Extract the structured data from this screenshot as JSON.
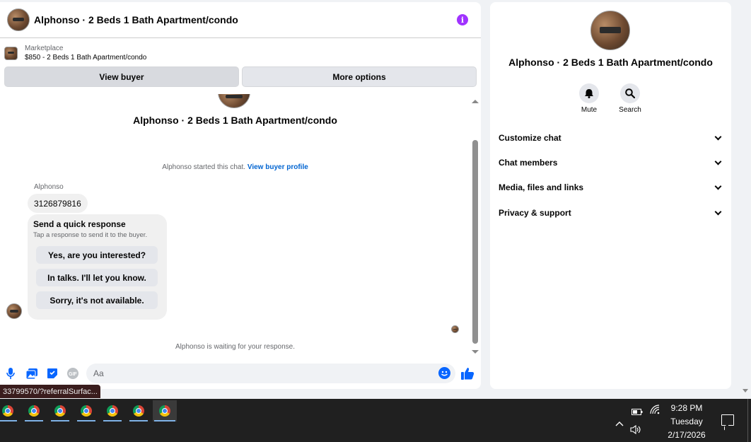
{
  "chat": {
    "title": "Alphonso · 2 Beds 1 Bath Apartment/condo",
    "info_icon": "i",
    "marketplace": {
      "label": "Marketplace",
      "listing": "$850 - 2 Beds 1 Bath Apartment/condo"
    },
    "actions": {
      "view_buyer": "View buyer",
      "more_options": "More options"
    },
    "thread": {
      "name": "Alphonso · 2 Beds 1 Bath Apartment/condo",
      "started_text": "Alphonso started this chat.",
      "started_link": "View buyer profile",
      "sender": "Alphonso",
      "phone_message": "3126879816",
      "quick_response": {
        "title": "Send a quick response",
        "subtitle": "Tap a response to send it to the buyer.",
        "options": [
          "Yes, are you interested?",
          "In talks. I'll let you know.",
          "Sorry, it's not available."
        ]
      },
      "waiting_text": "Alphonso is waiting for your response."
    },
    "composer": {
      "placeholder": "Aa",
      "gif_label": "GIF"
    }
  },
  "details": {
    "name": "Alphonso · 2 Beds 1 Bath Apartment/condo",
    "actions": [
      {
        "label": "Mute",
        "icon": "bell-icon"
      },
      {
        "label": "Search",
        "icon": "search-icon"
      }
    ],
    "sections": [
      "Customize chat",
      "Chat members",
      "Media, files and links",
      "Privacy & support"
    ]
  },
  "status_url": "33799570/?referralSurfac...",
  "taskbar": {
    "app_count": 7,
    "time": "9:28 PM",
    "day": "Tuesday",
    "date": "2/17/2026"
  },
  "colors": {
    "accent_blue": "#0866ff",
    "info_purple": "#a033ff",
    "link_blue": "#0064d1"
  }
}
